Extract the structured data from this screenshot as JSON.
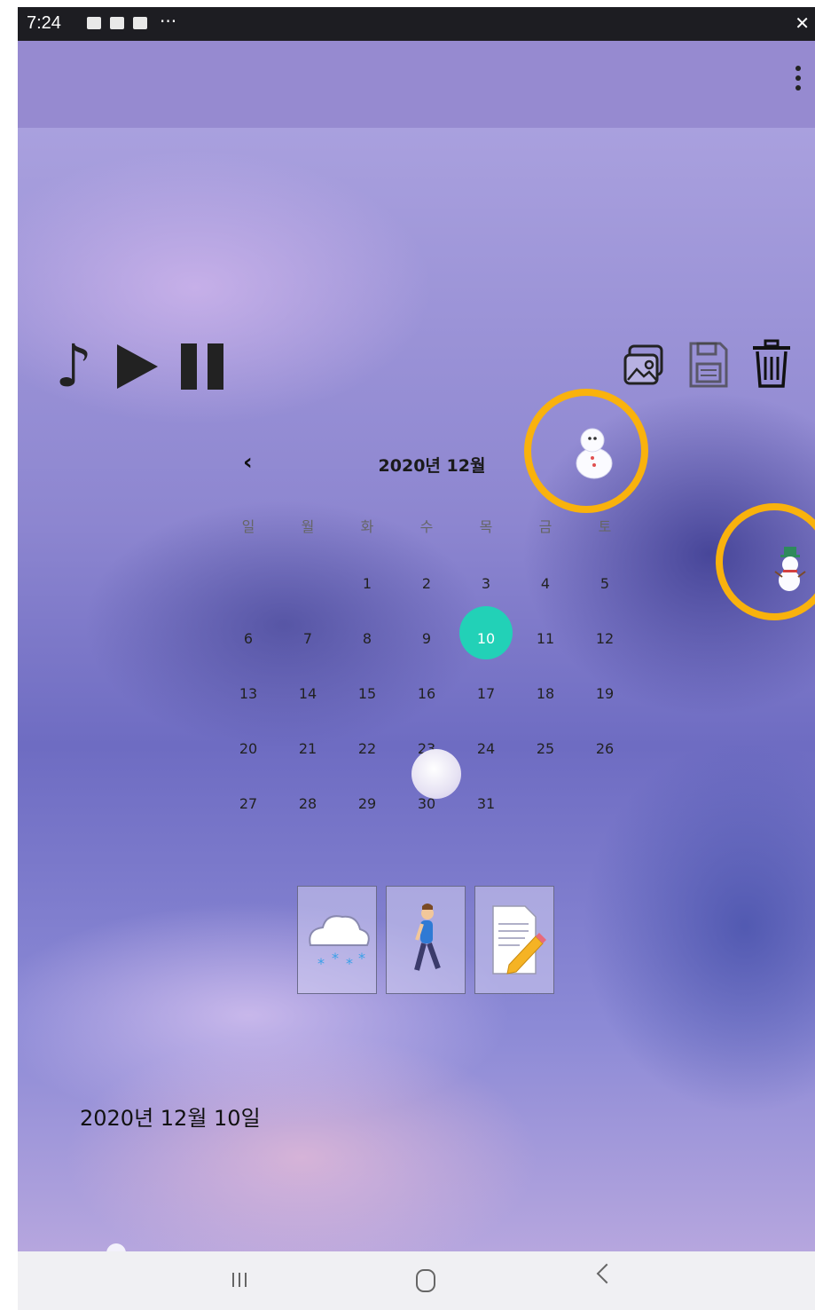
{
  "status_bar": {
    "time": "7:24",
    "more": "···"
  },
  "calendar": {
    "title": "2020년 12월",
    "prev": "‹",
    "next": "›",
    "weekdays": [
      "일",
      "월",
      "화",
      "수",
      "목",
      "금",
      "토"
    ],
    "weeks": [
      [
        "",
        "",
        "1",
        "2",
        "3",
        "4",
        "5"
      ],
      [
        "6",
        "7",
        "8",
        "9",
        "10",
        "11",
        "12"
      ],
      [
        "13",
        "14",
        "15",
        "16",
        "17",
        "18",
        "19"
      ],
      [
        "20",
        "21",
        "22",
        "23",
        "24",
        "25",
        "26"
      ],
      [
        "27",
        "28",
        "29",
        "30",
        "31",
        "",
        ""
      ]
    ],
    "selected_day": "10",
    "selected_color": "#22d1b7"
  },
  "media_controls": {
    "icons": [
      "music-note-icon",
      "play-icon",
      "pause-icon"
    ],
    "music_note": "♪"
  },
  "actions": {
    "icons": [
      "gallery-icon",
      "save-icon",
      "trash-icon"
    ]
  },
  "tiles": {
    "icons": [
      "snow-cloud-icon",
      "walking-person-icon",
      "memo-pencil-icon"
    ]
  },
  "selected_date_label": "2020년 12월 10일",
  "highlight_color": "#f9b20d",
  "nav_bar": {
    "icons": [
      "recents-icon",
      "home-icon",
      "back-icon"
    ]
  }
}
